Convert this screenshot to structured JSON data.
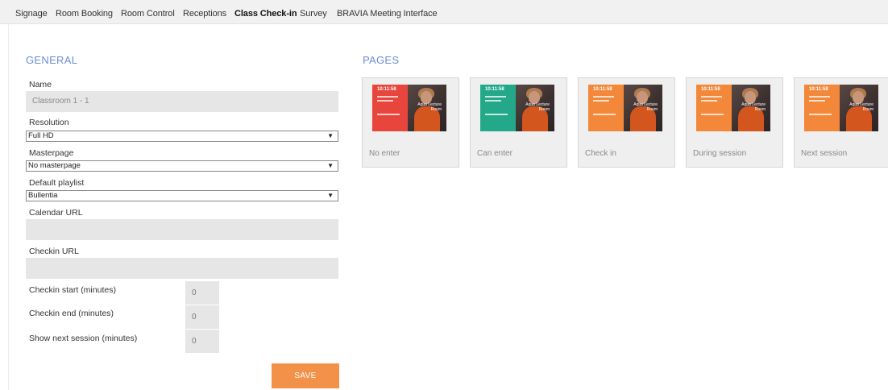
{
  "tabs": [
    {
      "label": "Signage",
      "active": false
    },
    {
      "label": "Room Booking",
      "active": false
    },
    {
      "label": "Room Control",
      "active": false
    },
    {
      "label": "Receptions",
      "active": false
    },
    {
      "label": "Class Check-in",
      "active": true
    },
    {
      "label": "Survey",
      "active": false
    },
    {
      "label": "BRAVIA Meeting Interface",
      "active": false
    }
  ],
  "general": {
    "title": "GENERAL",
    "name_label": "Name",
    "name_value": "Classroom 1 - 1",
    "resolution_label": "Resolution",
    "resolution_value": "Full HD",
    "masterpage_label": "Masterpage",
    "masterpage_value": "No masterpage",
    "playlist_label": "Default playlist",
    "playlist_value": "Bullentia",
    "calendar_url_label": "Calendar URL",
    "calendar_url_value": "",
    "checkin_url_label": "Checkin URL",
    "checkin_url_value": "",
    "checkin_start_label": "Checkin start (minutes)",
    "checkin_start_value": "0",
    "checkin_end_label": "Checkin end (minutes)",
    "checkin_end_value": "0",
    "next_session_label": "Show next session (minutes)",
    "next_session_value": "0",
    "save_label": "SAVE"
  },
  "pages": {
    "title": "PAGES",
    "thumb_time": "10:11:58",
    "thumb_room": "Aqua Lecture Room",
    "items": [
      {
        "label": "No enter",
        "panel_color": "#e8453c"
      },
      {
        "label": "Can enter",
        "panel_color": "#23a98a"
      },
      {
        "label": "Check in",
        "panel_color": "#f3883a"
      },
      {
        "label": "During session",
        "panel_color": "#f3883a"
      },
      {
        "label": "Next session",
        "panel_color": "#f3883a"
      }
    ]
  },
  "colors": {
    "accent": "#f39148",
    "section_title": "#6b8fd6"
  }
}
